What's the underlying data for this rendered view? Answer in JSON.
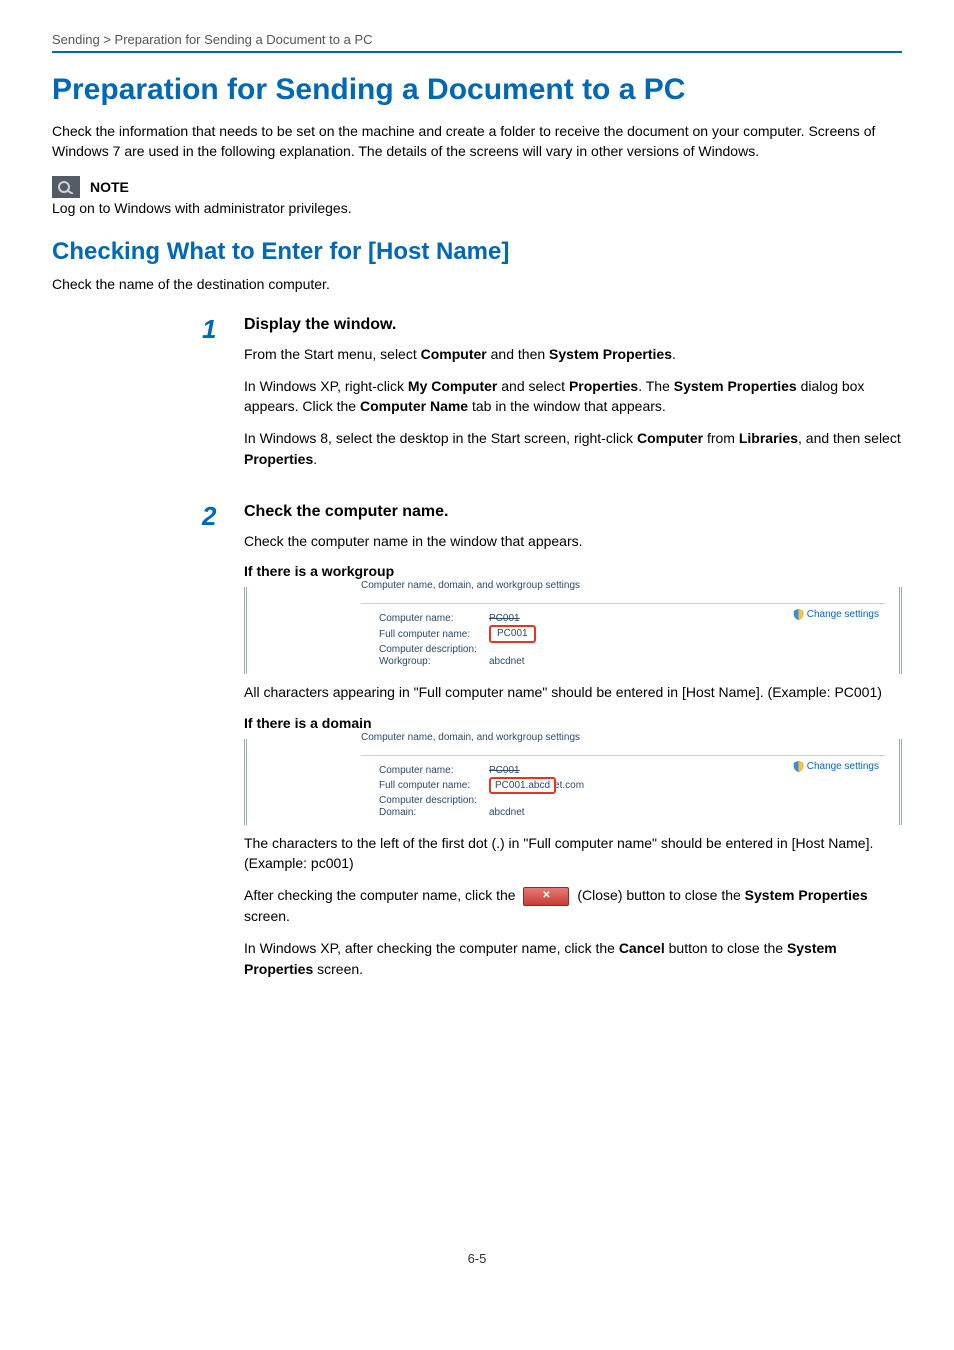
{
  "breadcrumb": "Sending > Preparation for Sending a Document to a PC",
  "title": "Preparation for Sending a Document to a PC",
  "intro": "Check the information that needs to be set on the machine and create a folder to receive the document on your computer. Screens of Windows 7 are used in the following explanation. The details of the screens will vary in other versions of Windows.",
  "note_label": "NOTE",
  "note_text": "Log on to Windows with administrator privileges.",
  "section_title": "Checking What to Enter for [Host Name]",
  "section_lead": "Check the name of the destination computer.",
  "step1": {
    "num": "1",
    "heading": "Display the window.",
    "p1_a": "From the Start menu, select ",
    "p1_b": "Computer",
    "p1_c": " and then ",
    "p1_d": "System Properties",
    "p1_e": ".",
    "p2_a": "In Windows XP, right-click ",
    "p2_b": "My Computer",
    "p2_c": " and select ",
    "p2_d": "Properties",
    "p2_e": ". The ",
    "p2_f": "System Properties",
    "p2_g": " dialog box appears. Click the ",
    "p2_h": "Computer Name",
    "p2_i": " tab in the window that appears.",
    "p3_a": "In Windows 8, select the desktop in the Start screen, right-click ",
    "p3_b": "Computer",
    "p3_c": " from ",
    "p3_d": "Libraries",
    "p3_e": ", and then select ",
    "p3_f": "Properties",
    "p3_g": "."
  },
  "step2": {
    "num": "2",
    "heading": "Check the computer name.",
    "lead": "Check the computer name in the window that appears.",
    "sub_workgroup": "If there is a workgroup",
    "sub_domain": "If there is a domain",
    "wg_legend": "Computer name, domain, and workgroup settings",
    "wg_k1": "Computer name:",
    "wg_v1": "PC001",
    "wg_k2": "Full computer name:",
    "wg_v2": "PC001",
    "wg_k3": "Computer description:",
    "wg_k4": "Workgroup:",
    "wg_v4": "abcdnet",
    "change_settings": "Change settings",
    "wg_expl": "All characters appearing in \"Full computer name\" should be entered in [Host Name]. (Example: PC001)",
    "dm_k1": "Computer name:",
    "dm_v1": "PC001",
    "dm_k2": "Full computer name:",
    "dm_v2_boxed": "PC001.abcd",
    "dm_v2_tail": "et.com",
    "dm_k3": "Computer description:",
    "dm_k4": "Domain:",
    "dm_v4": "abcdnet",
    "dm_expl": "The characters to the left of the first dot (.) in \"Full computer name\" should be entered in [Host Name]. (Example: pc001)",
    "close_a": "After checking the computer name, click the ",
    "close_b": " (Close) button to close the ",
    "close_c": "System Properties",
    "close_d": " screen.",
    "xp_a": "In Windows XP, after checking the computer name, click the ",
    "xp_b": "Cancel",
    "xp_c": " button to close the ",
    "xp_d": "System Properties",
    "xp_e": " screen."
  },
  "page_number": "6-5"
}
